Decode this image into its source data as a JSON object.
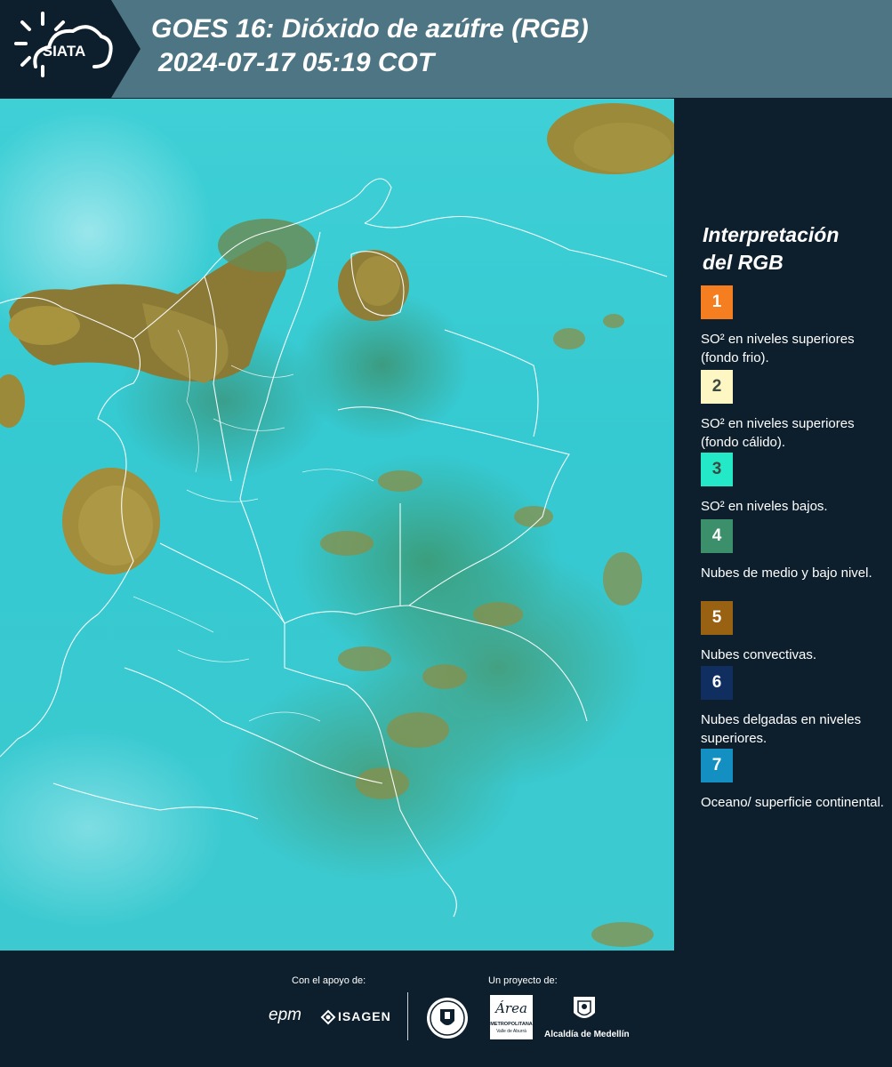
{
  "header": {
    "logo_text": "SIATA",
    "title_line1": "GOES 16: Dióxido de azúfre (RGB)",
    "title_line2": "2024-07-17 05:19 COT"
  },
  "legend": {
    "title_line1": "Interpretación",
    "title_line2": "del RGB",
    "items": [
      {
        "number": "1",
        "color": "#f47e20",
        "label": "SO² en niveles superiores (fondo frio)."
      },
      {
        "number": "2",
        "color": "#fef7c4",
        "label": "SO² en niveles superiores (fondo cálido)."
      },
      {
        "number": "3",
        "color": "#24e9c8",
        "label": "SO² en niveles bajos."
      },
      {
        "number": "4",
        "color": "#3b8f6a",
        "label": "Nubes de medio y bajo nivel."
      },
      {
        "number": "5",
        "color": "#996212",
        "label": "Nubes convectivas."
      },
      {
        "number": "6",
        "color": "#112e60",
        "label": "Nubes delgadas en niveles superiores."
      },
      {
        "number": "7",
        "color": "#1390c1",
        "label": "Oceano/ superficie continental."
      }
    ]
  },
  "footer": {
    "support_caption": "Con el apoyo de:",
    "project_caption": "Un proyecto de:",
    "epm_logo": "epm",
    "isagen_logo": "ISAGEN",
    "area_logo": "Área",
    "area_sub": "METROPOLITANA",
    "area_sub2": "Valle de Aburrá",
    "medellin_logo": "Alcaldía de Medellín"
  }
}
